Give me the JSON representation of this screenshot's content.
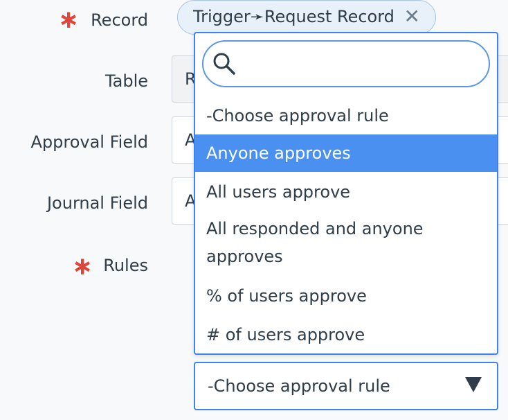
{
  "form": {
    "record_label": "Record",
    "table_label": "Table",
    "approval_field_label": "Approval Field",
    "journal_field_label": "Journal Field",
    "rules_label": "Rules",
    "required_marker": "∗",
    "record_pill": "Trigger➛Request Record",
    "record_pill_remove": "✕",
    "table_value": "R",
    "approval_field_value": "A",
    "journal_field_value": "A"
  },
  "dropdown": {
    "search_value": "",
    "search_placeholder": "",
    "options": [
      {
        "label": "-Choose approval rule",
        "selected": false
      },
      {
        "label": "Anyone approves",
        "selected": true
      },
      {
        "label": "All users approve",
        "selected": false
      },
      {
        "label": "All responded and anyone approves",
        "selected": false
      },
      {
        "label": "% of users approve",
        "selected": false
      },
      {
        "label": "# of users approve",
        "selected": false
      }
    ]
  },
  "rules_select": {
    "value": "-Choose approval rule"
  },
  "colors": {
    "accent": "#3b82f6",
    "selected_bg": "#4a90f0",
    "required": "#e0453a"
  }
}
